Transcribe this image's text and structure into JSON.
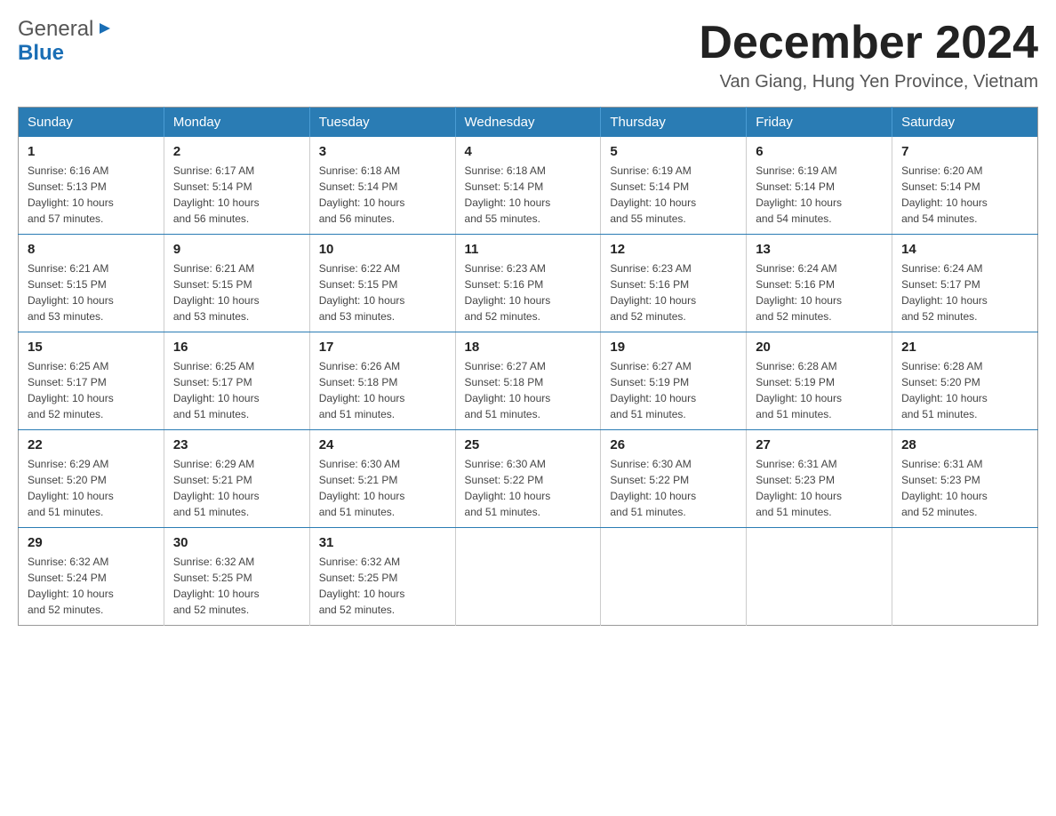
{
  "logo": {
    "general": "General",
    "blue": "Blue",
    "arrow_symbol": "▶"
  },
  "header": {
    "month_year": "December 2024",
    "location": "Van Giang, Hung Yen Province, Vietnam"
  },
  "weekdays": [
    "Sunday",
    "Monday",
    "Tuesday",
    "Wednesday",
    "Thursday",
    "Friday",
    "Saturday"
  ],
  "weeks": [
    [
      {
        "day": "1",
        "sunrise": "6:16 AM",
        "sunset": "5:13 PM",
        "daylight": "10 hours and 57 minutes."
      },
      {
        "day": "2",
        "sunrise": "6:17 AM",
        "sunset": "5:14 PM",
        "daylight": "10 hours and 56 minutes."
      },
      {
        "day": "3",
        "sunrise": "6:18 AM",
        "sunset": "5:14 PM",
        "daylight": "10 hours and 56 minutes."
      },
      {
        "day": "4",
        "sunrise": "6:18 AM",
        "sunset": "5:14 PM",
        "daylight": "10 hours and 55 minutes."
      },
      {
        "day": "5",
        "sunrise": "6:19 AM",
        "sunset": "5:14 PM",
        "daylight": "10 hours and 55 minutes."
      },
      {
        "day": "6",
        "sunrise": "6:19 AM",
        "sunset": "5:14 PM",
        "daylight": "10 hours and 54 minutes."
      },
      {
        "day": "7",
        "sunrise": "6:20 AM",
        "sunset": "5:14 PM",
        "daylight": "10 hours and 54 minutes."
      }
    ],
    [
      {
        "day": "8",
        "sunrise": "6:21 AM",
        "sunset": "5:15 PM",
        "daylight": "10 hours and 53 minutes."
      },
      {
        "day": "9",
        "sunrise": "6:21 AM",
        "sunset": "5:15 PM",
        "daylight": "10 hours and 53 minutes."
      },
      {
        "day": "10",
        "sunrise": "6:22 AM",
        "sunset": "5:15 PM",
        "daylight": "10 hours and 53 minutes."
      },
      {
        "day": "11",
        "sunrise": "6:23 AM",
        "sunset": "5:16 PM",
        "daylight": "10 hours and 52 minutes."
      },
      {
        "day": "12",
        "sunrise": "6:23 AM",
        "sunset": "5:16 PM",
        "daylight": "10 hours and 52 minutes."
      },
      {
        "day": "13",
        "sunrise": "6:24 AM",
        "sunset": "5:16 PM",
        "daylight": "10 hours and 52 minutes."
      },
      {
        "day": "14",
        "sunrise": "6:24 AM",
        "sunset": "5:17 PM",
        "daylight": "10 hours and 52 minutes."
      }
    ],
    [
      {
        "day": "15",
        "sunrise": "6:25 AM",
        "sunset": "5:17 PM",
        "daylight": "10 hours and 52 minutes."
      },
      {
        "day": "16",
        "sunrise": "6:25 AM",
        "sunset": "5:17 PM",
        "daylight": "10 hours and 51 minutes."
      },
      {
        "day": "17",
        "sunrise": "6:26 AM",
        "sunset": "5:18 PM",
        "daylight": "10 hours and 51 minutes."
      },
      {
        "day": "18",
        "sunrise": "6:27 AM",
        "sunset": "5:18 PM",
        "daylight": "10 hours and 51 minutes."
      },
      {
        "day": "19",
        "sunrise": "6:27 AM",
        "sunset": "5:19 PM",
        "daylight": "10 hours and 51 minutes."
      },
      {
        "day": "20",
        "sunrise": "6:28 AM",
        "sunset": "5:19 PM",
        "daylight": "10 hours and 51 minutes."
      },
      {
        "day": "21",
        "sunrise": "6:28 AM",
        "sunset": "5:20 PM",
        "daylight": "10 hours and 51 minutes."
      }
    ],
    [
      {
        "day": "22",
        "sunrise": "6:29 AM",
        "sunset": "5:20 PM",
        "daylight": "10 hours and 51 minutes."
      },
      {
        "day": "23",
        "sunrise": "6:29 AM",
        "sunset": "5:21 PM",
        "daylight": "10 hours and 51 minutes."
      },
      {
        "day": "24",
        "sunrise": "6:30 AM",
        "sunset": "5:21 PM",
        "daylight": "10 hours and 51 minutes."
      },
      {
        "day": "25",
        "sunrise": "6:30 AM",
        "sunset": "5:22 PM",
        "daylight": "10 hours and 51 minutes."
      },
      {
        "day": "26",
        "sunrise": "6:30 AM",
        "sunset": "5:22 PM",
        "daylight": "10 hours and 51 minutes."
      },
      {
        "day": "27",
        "sunrise": "6:31 AM",
        "sunset": "5:23 PM",
        "daylight": "10 hours and 51 minutes."
      },
      {
        "day": "28",
        "sunrise": "6:31 AM",
        "sunset": "5:23 PM",
        "daylight": "10 hours and 52 minutes."
      }
    ],
    [
      {
        "day": "29",
        "sunrise": "6:32 AM",
        "sunset": "5:24 PM",
        "daylight": "10 hours and 52 minutes."
      },
      {
        "day": "30",
        "sunrise": "6:32 AM",
        "sunset": "5:25 PM",
        "daylight": "10 hours and 52 minutes."
      },
      {
        "day": "31",
        "sunrise": "6:32 AM",
        "sunset": "5:25 PM",
        "daylight": "10 hours and 52 minutes."
      },
      null,
      null,
      null,
      null
    ]
  ],
  "labels": {
    "sunrise": "Sunrise:",
    "sunset": "Sunset:",
    "daylight": "Daylight:"
  }
}
